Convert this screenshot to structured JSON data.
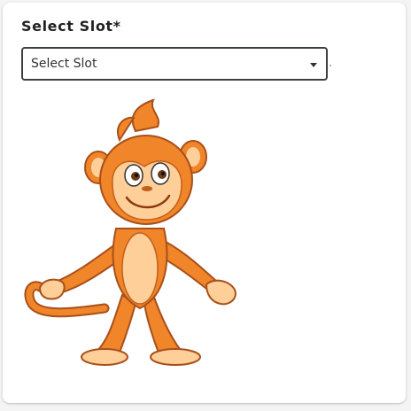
{
  "form": {
    "label": "Select Slot*",
    "select": {
      "selected": "Select Slot"
    }
  },
  "illustration": {
    "name": "monkey-mascot",
    "colors": {
      "fur": "#f0852a",
      "fur_dark": "#c2601a",
      "skin": "#ffcf9a",
      "outline": "#a8501a"
    }
  },
  "icons": [
    "chevron-down-icon"
  ]
}
